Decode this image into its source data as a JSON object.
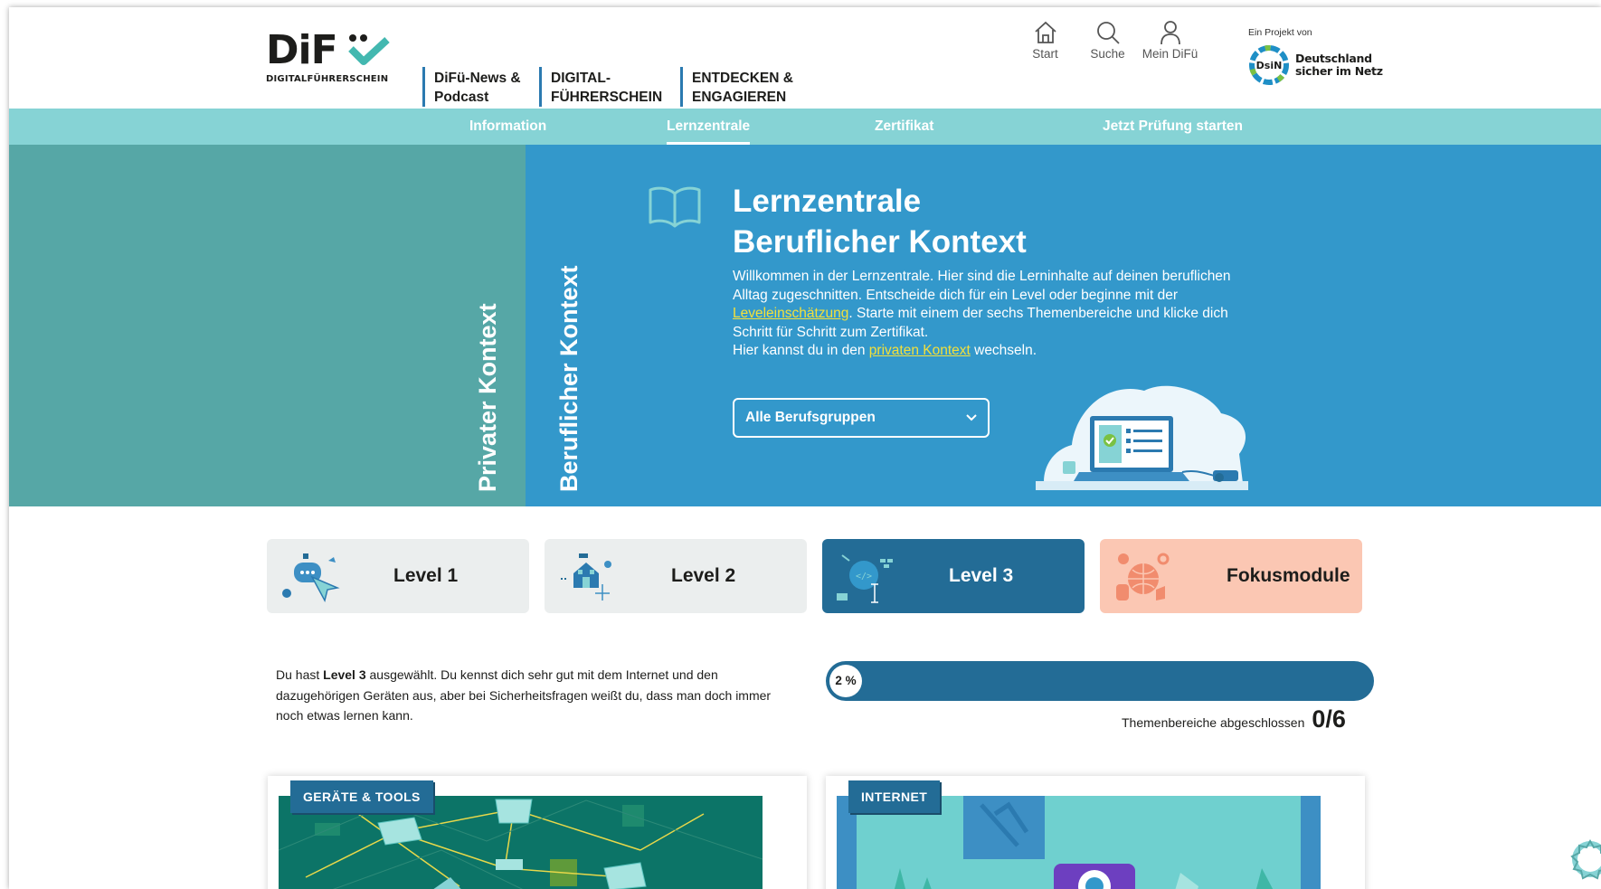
{
  "header": {
    "logo": {
      "wordmark": "DiF",
      "subtitle": "DIGITALFÜHRERSCHEIN"
    },
    "main_nav": [
      {
        "label": "DiFü-News &\nPodcast"
      },
      {
        "label": "DIGITAL-\nFÜHRERSCHEIN"
      },
      {
        "label": "ENTDECKEN &\nENGAGIEREN"
      }
    ],
    "icon_nav": [
      {
        "icon": "home-icon",
        "label": "Start"
      },
      {
        "icon": "search-icon",
        "label": "Suche"
      },
      {
        "icon": "user-icon",
        "label": "Mein DiFü"
      }
    ],
    "partner": {
      "caption": "Ein Projekt von",
      "badge": "DsiN",
      "name": "Deutschland\nsicher im Netz"
    }
  },
  "subnav": {
    "items": [
      {
        "label": "Information",
        "active": false
      },
      {
        "label": "Lernzentrale",
        "active": true
      },
      {
        "label": "Zertifikat",
        "active": false
      },
      {
        "label": "Jetzt Prüfung starten",
        "active": false
      }
    ]
  },
  "hero": {
    "private_tab": "Privater Kontext",
    "business_tab": "Beruflicher Kontext",
    "icon": "open-book-icon",
    "title_line1": "Lernzentrale",
    "title_line2": "Beruflicher Kontext",
    "text_1": "Willkommen in der Lernzentrale. Hier sind die Lerninhalte auf deinen beruflichen Alltag zugeschnitten. Entscheide dich für ein Level oder beginne mit der ",
    "link_1": "Leveleinschätzung",
    "text_2": ". Starte mit einem der sechs Themenbereiche und klicke dich Schritt für Schritt zum Zertifikat.",
    "text_3": "Hier kannst du in den ",
    "link_2": "privaten Kontext",
    "text_4": " wechseln.",
    "select": {
      "value": "Alle Berufsgruppen",
      "icon": "chevron-down-icon"
    }
  },
  "levels": [
    {
      "label": "Level 1",
      "active": false
    },
    {
      "label": "Level 2",
      "active": false
    },
    {
      "label": "Level 3",
      "active": true
    },
    {
      "label": "Fokusmodule",
      "active": false
    }
  ],
  "description": {
    "prefix": "Du hast ",
    "bold": "Level 3",
    "suffix": " ausgewählt. Du kennst dich sehr gut mit dem Internet und den dazugehörigen Geräten aus, aber bei Sicherheitsfragen weißt du, dass man doch immer noch etwas lernen kann."
  },
  "progress": {
    "percent_label": "2 %",
    "percent": 2,
    "completed_label": "Themenbereiche abgeschlossen",
    "completed_value": "0/6"
  },
  "cards": [
    {
      "tag": "GERÄTE & TOOLS"
    },
    {
      "tag": "INTERNET"
    }
  ],
  "colors": {
    "hero_private": "#56a7a6",
    "hero_business": "#3398cb",
    "subnav": "#86d3d5",
    "level_active": "#236c96",
    "fokus": "#fbc7b3",
    "link": "#f3e03a"
  }
}
